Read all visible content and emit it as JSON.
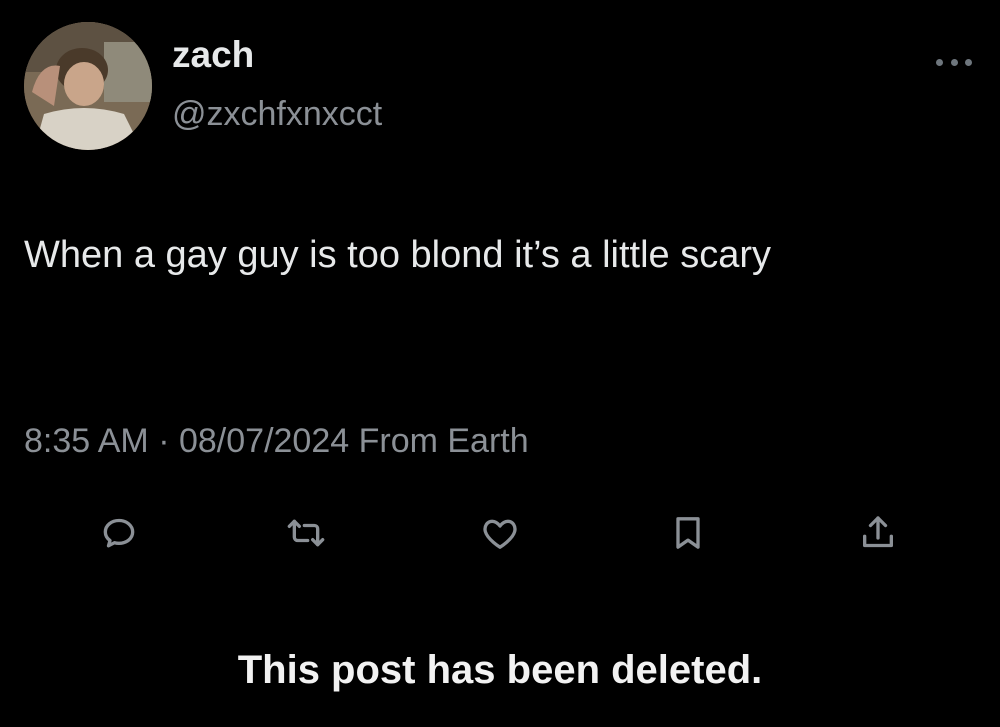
{
  "user": {
    "display_name": "zach",
    "handle": "@zxchfxnxcct"
  },
  "tweet": {
    "text": "When a gay guy is too blond it’s a little scary",
    "time": "8:35 AM",
    "separator": "·",
    "date": "08/07/2024",
    "source": "From Earth"
  },
  "actions": {
    "reply_icon": "reply-icon",
    "retweet_icon": "retweet-icon",
    "like_icon": "heart-icon",
    "bookmark_icon": "bookmark-icon",
    "share_icon": "share-icon"
  },
  "notice": "This post has been deleted.",
  "colors": {
    "background": "#000000",
    "primary_text": "#e7e9ea",
    "secondary_text": "#8b9096",
    "icon": "#8b9096"
  }
}
